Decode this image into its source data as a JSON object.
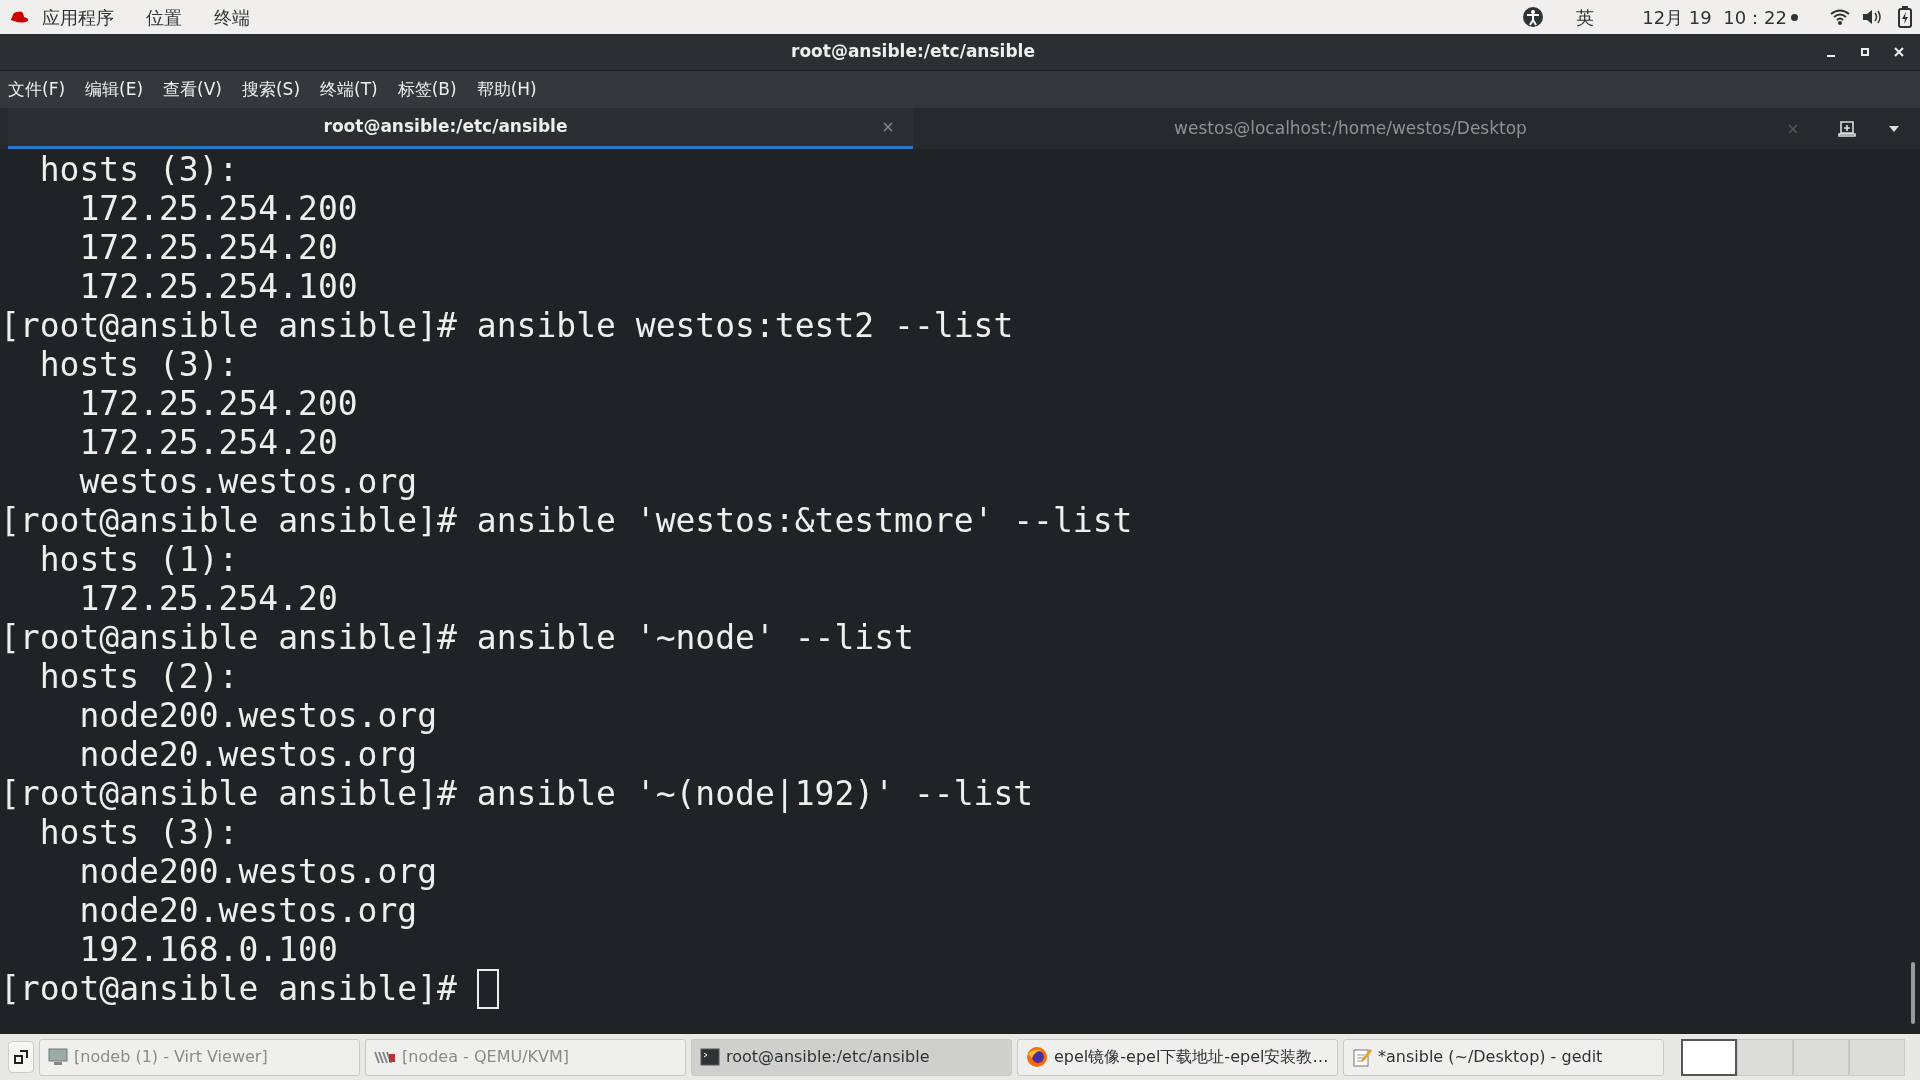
{
  "top_bar": {
    "menus": [
      "应用程序",
      "位置",
      "终端"
    ],
    "input_method": "英",
    "clock": "12月 19  10：22"
  },
  "window": {
    "title": "root@ansible:/etc/ansible"
  },
  "menu_bar": [
    "文件(F)",
    "编辑(E)",
    "查看(V)",
    "搜索(S)",
    "终端(T)",
    "标签(B)",
    "帮助(H)"
  ],
  "tabs": [
    {
      "label": "root@ansible:/etc/ansible",
      "selected": true
    },
    {
      "label": "westos@localhost:/home/westos/Desktop",
      "selected": false
    }
  ],
  "terminal": {
    "lines": [
      "  hosts (3):",
      "    172.25.254.200",
      "    172.25.254.20",
      "    172.25.254.100",
      "[root@ansible ansible]# ansible westos:test2 --list",
      "  hosts (3):",
      "    172.25.254.200",
      "    172.25.254.20",
      "    westos.westos.org",
      "[root@ansible ansible]# ansible 'westos:&testmore' --list",
      "  hosts (1):",
      "    172.25.254.20",
      "[root@ansible ansible]# ansible '~node' --list",
      "  hosts (2):",
      "    node200.westos.org",
      "    node20.westos.org",
      "[root@ansible ansible]# ansible '~(node|192)' --list",
      "  hosts (3):",
      "    node200.westos.org",
      "    node20.westos.org",
      "    192.168.0.100"
    ],
    "prompt": "[root@ansible ansible]# "
  },
  "taskbar": {
    "items": [
      {
        "label": "[nodeb (1) - Virt Viewer]",
        "kind": "viewer",
        "selected": false
      },
      {
        "label": "[nodea - QEMU/KVM]",
        "kind": "vm",
        "selected": false
      },
      {
        "label": "root@ansible:/etc/ansible",
        "kind": "terminal",
        "selected": true
      },
      {
        "label": "epel镜像-epel下载地址-epel安装教…",
        "kind": "browser",
        "selected": false
      },
      {
        "label": "*ansible (~/Desktop) - gedit",
        "kind": "editor",
        "selected": false
      }
    ],
    "workspaces": [
      {
        "selected": true
      },
      {
        "selected": false
      },
      {
        "selected": false
      },
      {
        "selected": false
      }
    ]
  }
}
